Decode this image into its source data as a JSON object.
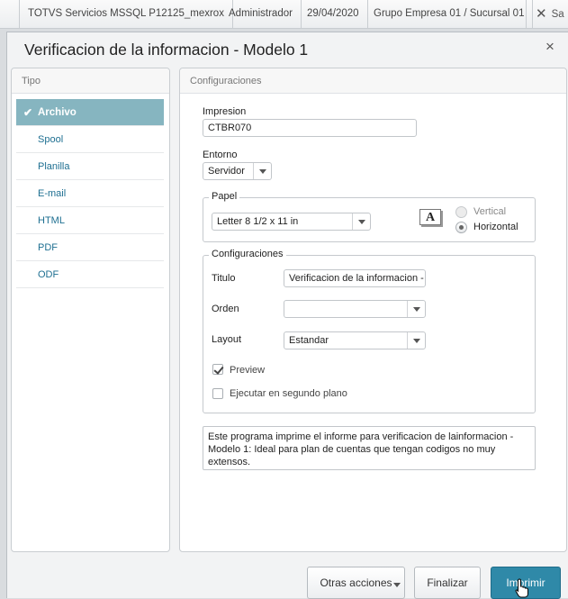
{
  "topbar": {
    "app": "TOTVS Servicios MSSQL P12125_mexrox",
    "user": "Administrador",
    "date": "29/04/2020",
    "company": "Grupo Empresa 01 / Sucursal 01",
    "exit_label": "Sa"
  },
  "dialog": {
    "title": "Verificacion de la informacion - Modelo 1",
    "close": "×"
  },
  "tipo": {
    "header": "Tipo",
    "items": [
      "Archivo",
      "Spool",
      "Planilla",
      "E-mail",
      "HTML",
      "PDF",
      "ODF"
    ],
    "selected": "Archivo"
  },
  "config": {
    "header": "Configuraciones",
    "impresion_label": "Impresion",
    "impresion_value": "CTBR070",
    "entorno_label": "Entorno",
    "entorno_value": "Servidor",
    "papel": {
      "legend": "Papel",
      "size_value": "Letter 8 1/2 x 11 in",
      "icon_letter": "A",
      "vertical_label": "Vertical",
      "horizontal_label": "Horizontal",
      "orientation": "Horizontal"
    },
    "sub": {
      "legend": "Configuraciones",
      "titulo_label": "Titulo",
      "titulo_value": "Verificacion de la informacion -",
      "orden_label": "Orden",
      "orden_value": "",
      "layout_label": "Layout",
      "layout_value": "Estandar",
      "preview_label": "Preview",
      "preview_checked": true,
      "background_label": "Ejecutar en segundo plano",
      "background_checked": false
    },
    "description": "Este programa imprime el informe para verificacion de lainformacion - Modelo 1: Ideal para plan de cuentas que tengan codigos no muy extensos."
  },
  "footer": {
    "otras_label": "Otras acciones",
    "finalizar_label": "Finalizar",
    "imprimir_label": "Imprimir"
  },
  "colors": {
    "accent": "#2f89a8",
    "selected_item": "#86b5c0",
    "link": "#1e6f91"
  }
}
